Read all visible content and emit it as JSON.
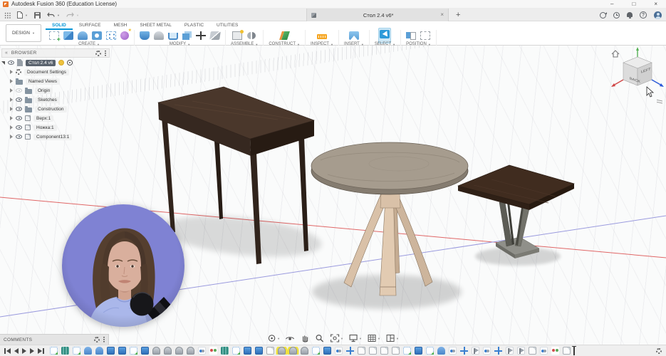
{
  "window": {
    "title": "Autodesk Fusion 360 (Education License)",
    "minimize": "–",
    "maximize": "□",
    "close": "×"
  },
  "quick_access": {
    "icons": [
      "app-grid",
      "file-new",
      "save",
      "undo",
      "redo"
    ]
  },
  "tab_strip": {
    "document_tab": {
      "label": "Стол 2.4 v6*",
      "close": "×"
    },
    "new_tab": "+",
    "right_icons": [
      "extensions",
      "job-status",
      "notifications",
      "help",
      "profile"
    ]
  },
  "ribbon": {
    "workspace_button": "DESIGN",
    "tabs": [
      "SOLID",
      "SURFACE",
      "MESH",
      "SHEET METAL",
      "PLASTIC",
      "UTILITIES"
    ],
    "active_tab": "SOLID",
    "groups": [
      "CREATE",
      "MODIFY",
      "ASSEMBLE",
      "CONSTRUCT",
      "INSPECT",
      "INSERT",
      "SELECT",
      "POSITION"
    ],
    "group_icons": {
      "CREATE": [
        "create-sketch",
        "extrude",
        "revolve",
        "hole",
        "pattern",
        "form"
      ],
      "MODIFY": [
        "press-pull",
        "fillet",
        "shell",
        "combine",
        "move",
        "split"
      ],
      "ASSEMBLE": [
        "new-component",
        "joint"
      ],
      "CONSTRUCT": [
        "construction-plane"
      ],
      "INSPECT": [
        "measure"
      ],
      "INSERT": [
        "insert-image"
      ],
      "SELECT": [
        "select"
      ],
      "POSITION": [
        "capture-position",
        "revert-position"
      ]
    }
  },
  "browser": {
    "header": "BROWSER",
    "root": "Стол 2.4 v6",
    "items": [
      {
        "label": "Document Settings",
        "icon": "gear",
        "eye": false,
        "visible": true
      },
      {
        "label": "Named Views",
        "icon": "folder",
        "eye": false,
        "visible": true
      },
      {
        "label": "Origin",
        "icon": "folder",
        "eye": true,
        "visible": false
      },
      {
        "label": "Sketches",
        "icon": "folder",
        "eye": true,
        "visible": true
      },
      {
        "label": "Construction",
        "icon": "folder",
        "eye": true,
        "visible": true
      },
      {
        "label": "Верх:1",
        "icon": "component",
        "eye": true,
        "visible": true
      },
      {
        "label": "Ножка:1",
        "icon": "component",
        "eye": true,
        "visible": true
      },
      {
        "label": "Component13:1",
        "icon": "component",
        "eye": true,
        "visible": true
      }
    ]
  },
  "viewcube": {
    "face_left": "BACK",
    "face_right": "LEFT"
  },
  "comments_bar": {
    "label": "COMMENTS"
  },
  "nav_bar": {
    "icons": [
      "orbit",
      "look-at",
      "pan",
      "zoom",
      "fit",
      "display-settings",
      "grid-snaps",
      "viewports"
    ]
  },
  "timeline": {
    "playback": [
      "skip-to-start",
      "step-back",
      "play",
      "step-forward",
      "skip-to-end"
    ],
    "features": [
      "sk",
      "pl",
      "sk",
      "rv",
      "rv",
      "ex",
      "ex",
      "sk",
      "ex",
      "fi",
      "fi",
      "fi",
      "fi",
      "jt",
      "jo",
      "pl",
      "sk",
      "ex",
      "ex",
      "cp",
      "fi hl",
      "fi hl",
      "fi",
      "sk",
      "ex",
      "jt",
      "mv",
      "cp",
      "cp",
      "cp",
      "cp",
      "sk",
      "ex",
      "sk",
      "rv",
      "jt",
      "mv",
      "fl",
      "jt",
      "mv",
      "fl",
      "fl",
      "cp",
      "jt",
      "jo",
      "cp"
    ],
    "highlight_color": "#f1e23c"
  },
  "colors": {
    "accent": "#0696d7",
    "axis_x": "#e06666",
    "axis_z": "#9a9ade",
    "select_highlight": "#cfe8f6"
  }
}
